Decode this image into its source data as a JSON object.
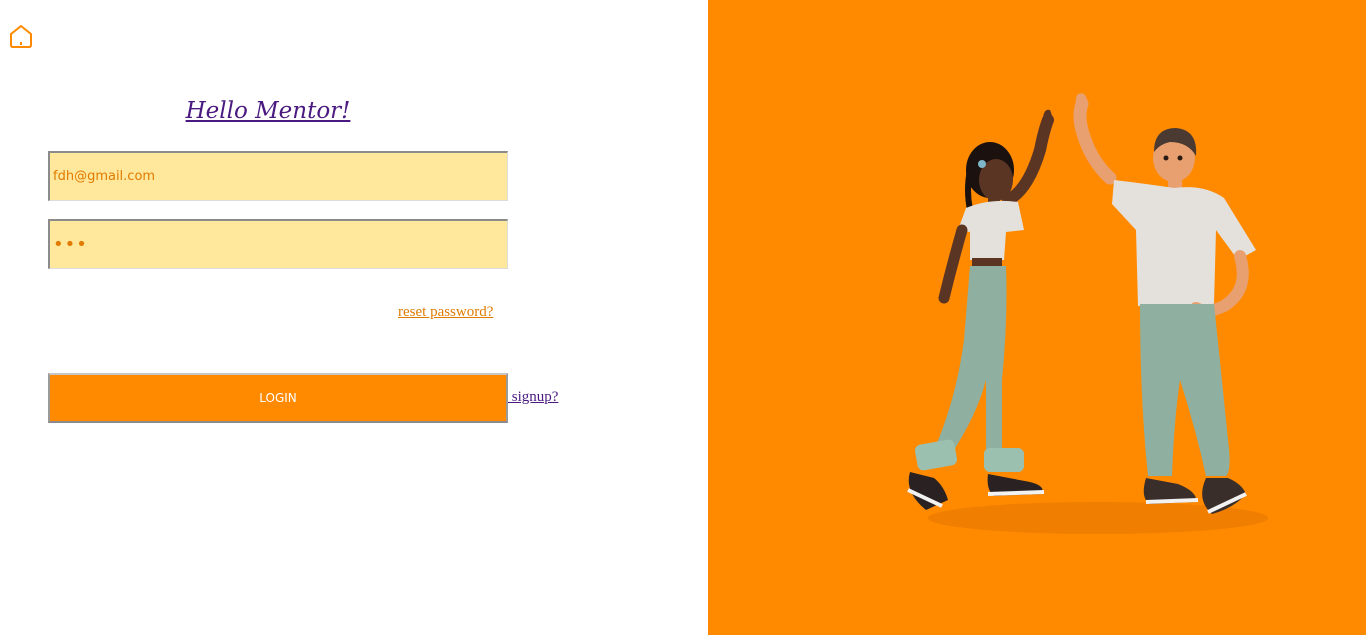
{
  "header": {
    "home_icon": "home-icon"
  },
  "form": {
    "title": "Hello Mentor!",
    "email_value": "fdh@gmail.com",
    "password_value": "•••",
    "reset_label": "reset password?",
    "login_label": "LOGIN",
    "signup_label": " signup?"
  },
  "illustration": {
    "name": "high-five-people-illustration"
  },
  "colors": {
    "accent": "#ff8a00",
    "input_bg": "#ffe79b",
    "title": "#4a1a80",
    "link_orange": "#e07b00"
  }
}
